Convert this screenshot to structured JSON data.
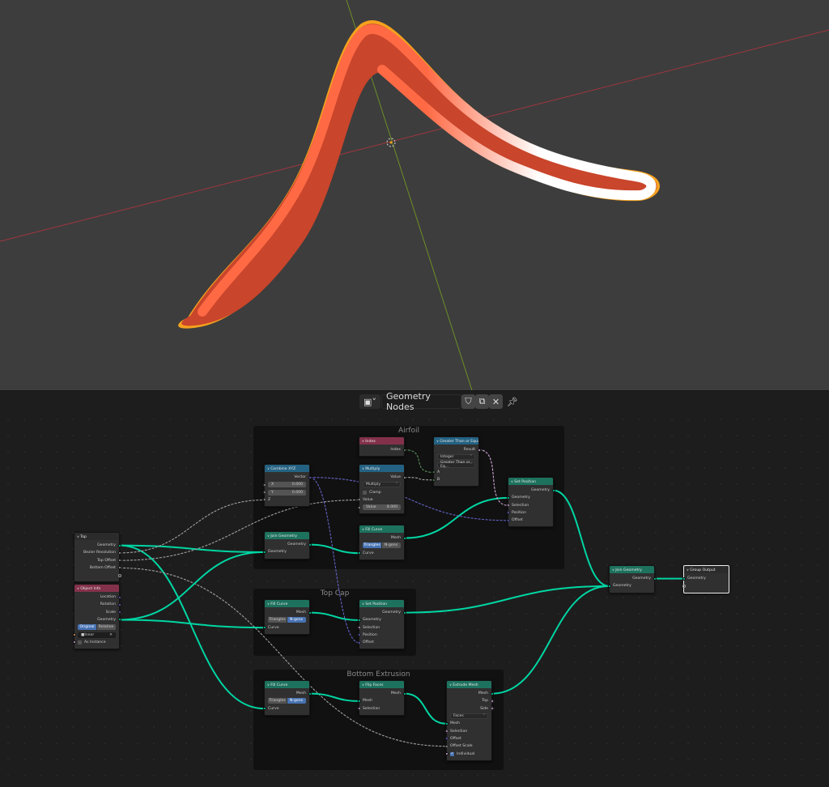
{
  "header": {
    "editor_type_icon": "node-editor-icon",
    "node_tree_name": "Geometry Nodes",
    "fake_user_icon": "shield-icon",
    "duplicate_icon": "duplicate-icon",
    "unlink_icon": "close-icon",
    "pin_icon": "pin-icon"
  },
  "colors": {
    "teal": "#00d6a3",
    "gray": "#a1a1a1",
    "purple": "#6363c7",
    "pink": "#cca6d6",
    "green": "#598c5c",
    "orange": "#ed9e5c",
    "geometry_header": "#1d725e",
    "input_header": "#83314a",
    "converter_header": "#246283",
    "group_header": "#2b2b2b",
    "object": "#e0502f"
  },
  "frames": [
    {
      "key": "airfoil",
      "label": "Airfoil"
    },
    {
      "key": "topcap",
      "label": "Top Cap"
    },
    {
      "key": "bottom",
      "label": "Bottom Extrusion"
    }
  ],
  "nodes": [
    {
      "key": "top",
      "title": "Top",
      "hc": "group_header",
      "rows": [
        {
          "t": "out",
          "label": "Geometry",
          "s": "teal"
        },
        {
          "t": "out",
          "label": "Bezier Resolution",
          "s": "gray"
        },
        {
          "t": "out",
          "label": "Top Offset",
          "s": "gray"
        },
        {
          "t": "out",
          "label": "Bottom Offset",
          "s": "gray"
        },
        {
          "t": "out",
          "label": "",
          "s": "empty"
        }
      ]
    },
    {
      "key": "objinfo",
      "title": "Object Info",
      "hc": "input_header",
      "rows": [
        {
          "t": "out",
          "label": "Location",
          "s": "purple"
        },
        {
          "t": "out",
          "label": "Rotation",
          "s": "purple"
        },
        {
          "t": "out",
          "label": "Scale",
          "s": "purple"
        },
        {
          "t": "out",
          "label": "Geometry",
          "s": "teal"
        },
        {
          "t": "toggle",
          "options": [
            "Original",
            "Relative"
          ],
          "active": 0
        },
        {
          "t": "infield",
          "label": "Inner",
          "s": "orange"
        },
        {
          "t": "incheck",
          "label": "As Instance",
          "s": "pink",
          "checked": false
        }
      ]
    },
    {
      "key": "combine",
      "title": "Combine XYZ",
      "hc": "converter_header",
      "rows": [
        {
          "t": "out",
          "label": "Vector",
          "s": "purple"
        },
        {
          "t": "field",
          "label": "X",
          "value": "0.000",
          "s": "gray",
          "dia": true
        },
        {
          "t": "field",
          "label": "Y",
          "value": "0.000",
          "s": "gray",
          "dia": true
        },
        {
          "t": "in",
          "label": "Z",
          "s": "gray",
          "dia": true
        }
      ]
    },
    {
      "key": "index",
      "title": "Index",
      "hc": "input_header",
      "rows": [
        {
          "t": "out",
          "label": "Index",
          "s": "green"
        }
      ]
    },
    {
      "key": "multiply",
      "title": "Multiply",
      "hc": "converter_header",
      "rows": [
        {
          "t": "out",
          "label": "Value",
          "s": "gray"
        },
        {
          "t": "dropdown",
          "value": "Multiply"
        },
        {
          "t": "check",
          "label": "Clamp",
          "checked": false
        },
        {
          "t": "in",
          "label": "Value",
          "s": "gray",
          "dia": true
        },
        {
          "t": "field",
          "label": "Value",
          "value": "8.000",
          "s": "gray",
          "dia": true
        }
      ]
    },
    {
      "key": "gte",
      "title": "Greater Than or Equal",
      "hc": "converter_header",
      "rows": [
        {
          "t": "out",
          "label": "Result",
          "s": "pink"
        },
        {
          "t": "dropdown",
          "value": "Integer"
        },
        {
          "t": "dropdown",
          "value": "Greater Than or Eq..."
        },
        {
          "t": "in",
          "label": "A",
          "s": "green"
        },
        {
          "t": "in",
          "label": "B",
          "s": "green"
        }
      ]
    },
    {
      "key": "setpos1",
      "title": "Set Position",
      "hc": "geometry_header",
      "rows": [
        {
          "t": "out",
          "label": "Geometry",
          "s": "teal"
        },
        {
          "t": "in",
          "label": "Geometry",
          "s": "teal"
        },
        {
          "t": "in",
          "label": "Selection",
          "s": "pink",
          "dia": true
        },
        {
          "t": "in",
          "label": "Position",
          "s": "purple",
          "dia": true
        },
        {
          "t": "in",
          "label": "Offset",
          "s": "purple",
          "dia": true
        }
      ]
    },
    {
      "key": "join1",
      "title": "Join Geometry",
      "hc": "geometry_header",
      "rows": [
        {
          "t": "out",
          "label": "Geometry",
          "s": "teal"
        },
        {
          "t": "in",
          "label": "Geometry",
          "s": "teal"
        }
      ]
    },
    {
      "key": "fill1",
      "title": "Fill Curve",
      "hc": "geometry_header",
      "rows": [
        {
          "t": "out",
          "label": "Mesh",
          "s": "teal"
        },
        {
          "t": "toggle",
          "options": [
            "Triangles",
            "N-gons"
          ],
          "active": 0
        },
        {
          "t": "in",
          "label": "Curve",
          "s": "teal"
        }
      ]
    },
    {
      "key": "fill2",
      "title": "Fill Curve",
      "hc": "geometry_header",
      "rows": [
        {
          "t": "out",
          "label": "Mesh",
          "s": "teal"
        },
        {
          "t": "toggle",
          "options": [
            "Triangles",
            "N-gons"
          ],
          "active": 1
        },
        {
          "t": "in",
          "label": "Curve",
          "s": "teal"
        }
      ]
    },
    {
      "key": "setpos2",
      "title": "Set Position",
      "hc": "geometry_header",
      "rows": [
        {
          "t": "out",
          "label": "Geometry",
          "s": "teal"
        },
        {
          "t": "in",
          "label": "Geometry",
          "s": "teal"
        },
        {
          "t": "in",
          "label": "Selection",
          "s": "pink",
          "dia": true
        },
        {
          "t": "in",
          "label": "Position",
          "s": "purple",
          "dia": true
        },
        {
          "t": "in",
          "label": "Offset",
          "s": "purple",
          "dia": true
        }
      ]
    },
    {
      "key": "fill3",
      "title": "Fill Curve",
      "hc": "geometry_header",
      "rows": [
        {
          "t": "out",
          "label": "Mesh",
          "s": "teal"
        },
        {
          "t": "toggle",
          "options": [
            "Triangles",
            "N-gons"
          ],
          "active": 1
        },
        {
          "t": "in",
          "label": "Curve",
          "s": "teal"
        }
      ]
    },
    {
      "key": "flip",
      "title": "Flip Faces",
      "hc": "geometry_header",
      "rows": [
        {
          "t": "out",
          "label": "Mesh",
          "s": "teal"
        },
        {
          "t": "in",
          "label": "Mesh",
          "s": "teal"
        },
        {
          "t": "in",
          "label": "Selection",
          "s": "pink",
          "dia": true
        }
      ]
    },
    {
      "key": "extrude",
      "title": "Extrude Mesh",
      "hc": "geometry_header",
      "rows": [
        {
          "t": "out",
          "label": "Mesh",
          "s": "teal"
        },
        {
          "t": "out",
          "label": "Top",
          "s": "pink",
          "dia": true
        },
        {
          "t": "out",
          "label": "Side",
          "s": "pink",
          "dia": true
        },
        {
          "t": "dropdown",
          "value": "Faces"
        },
        {
          "t": "in",
          "label": "Mesh",
          "s": "teal"
        },
        {
          "t": "in",
          "label": "Selection",
          "s": "pink",
          "dia": true
        },
        {
          "t": "in",
          "label": "Offset",
          "s": "purple",
          "dia": true
        },
        {
          "t": "in",
          "label": "Offset Scale",
          "s": "gray",
          "dia": true
        },
        {
          "t": "incheck",
          "label": "Individual",
          "s": "pink",
          "checked": true
        }
      ]
    },
    {
      "key": "join2",
      "title": "Join Geometry",
      "hc": "geometry_header",
      "rows": [
        {
          "t": "out",
          "label": "Geometry",
          "s": "teal"
        },
        {
          "t": "in",
          "label": "Geometry",
          "s": "teal"
        }
      ]
    },
    {
      "key": "groupout",
      "title": "Group Output",
      "hc": "group_header",
      "rows": [
        {
          "t": "in",
          "label": "Geometry",
          "s": "teal"
        },
        {
          "t": "in",
          "label": "",
          "s": "empty"
        }
      ]
    }
  ]
}
